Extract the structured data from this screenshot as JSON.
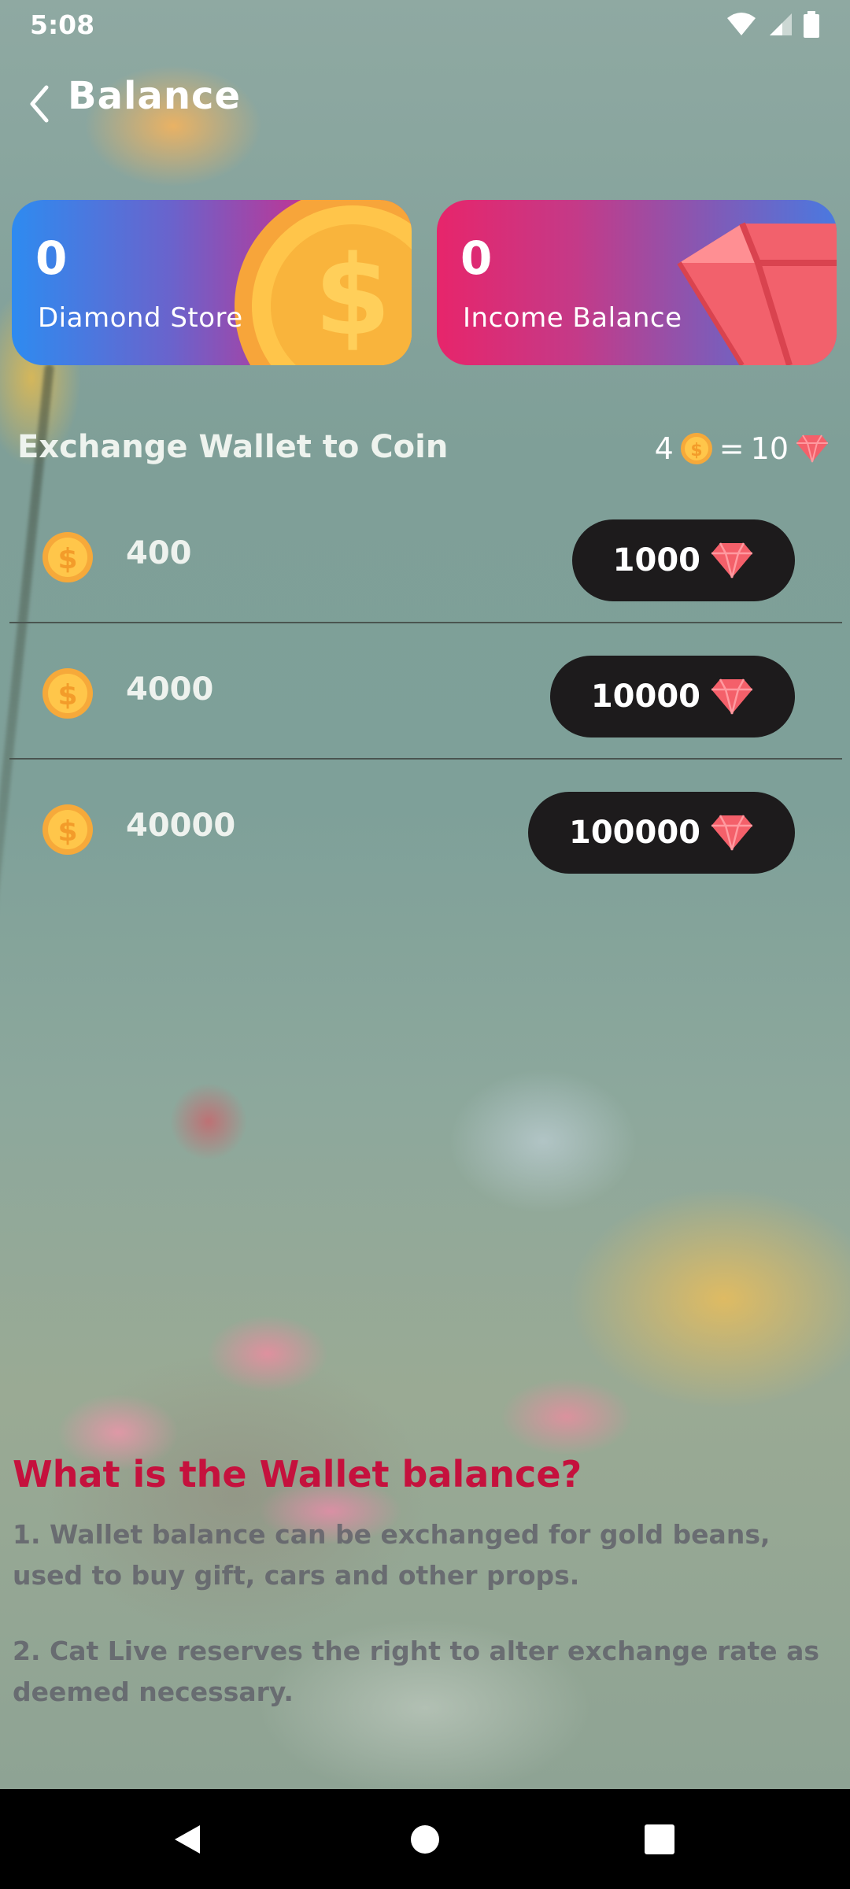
{
  "status_bar": {
    "time": "5:08"
  },
  "header": {
    "title": "Balance"
  },
  "cards": [
    {
      "value": "0",
      "label": "Diamond Store"
    },
    {
      "value": "0",
      "label": "Income Balance"
    }
  ],
  "exchange": {
    "title": "Exchange Wallet to Coin",
    "rate": {
      "coins": "4",
      "equals": "=",
      "diamonds": "10"
    },
    "options": [
      {
        "coins": "400",
        "price": "1000"
      },
      {
        "coins": "4000",
        "price": "10000"
      },
      {
        "coins": "40000",
        "price": "100000"
      }
    ]
  },
  "info": {
    "title": "What is the Wallet balance?",
    "paragraphs": [
      "1. Wallet balance can be exchanged for gold beans, used to buy gift, cars and other props.",
      "2. Cat Live reserves the right to alter exchange rate as deemed necessary."
    ]
  },
  "colors": {
    "info_title": "#c5113d",
    "button_bg": "#1d1b1c",
    "diamond_card_start": "#2e8bf0",
    "income_card_start": "#e7256b"
  }
}
